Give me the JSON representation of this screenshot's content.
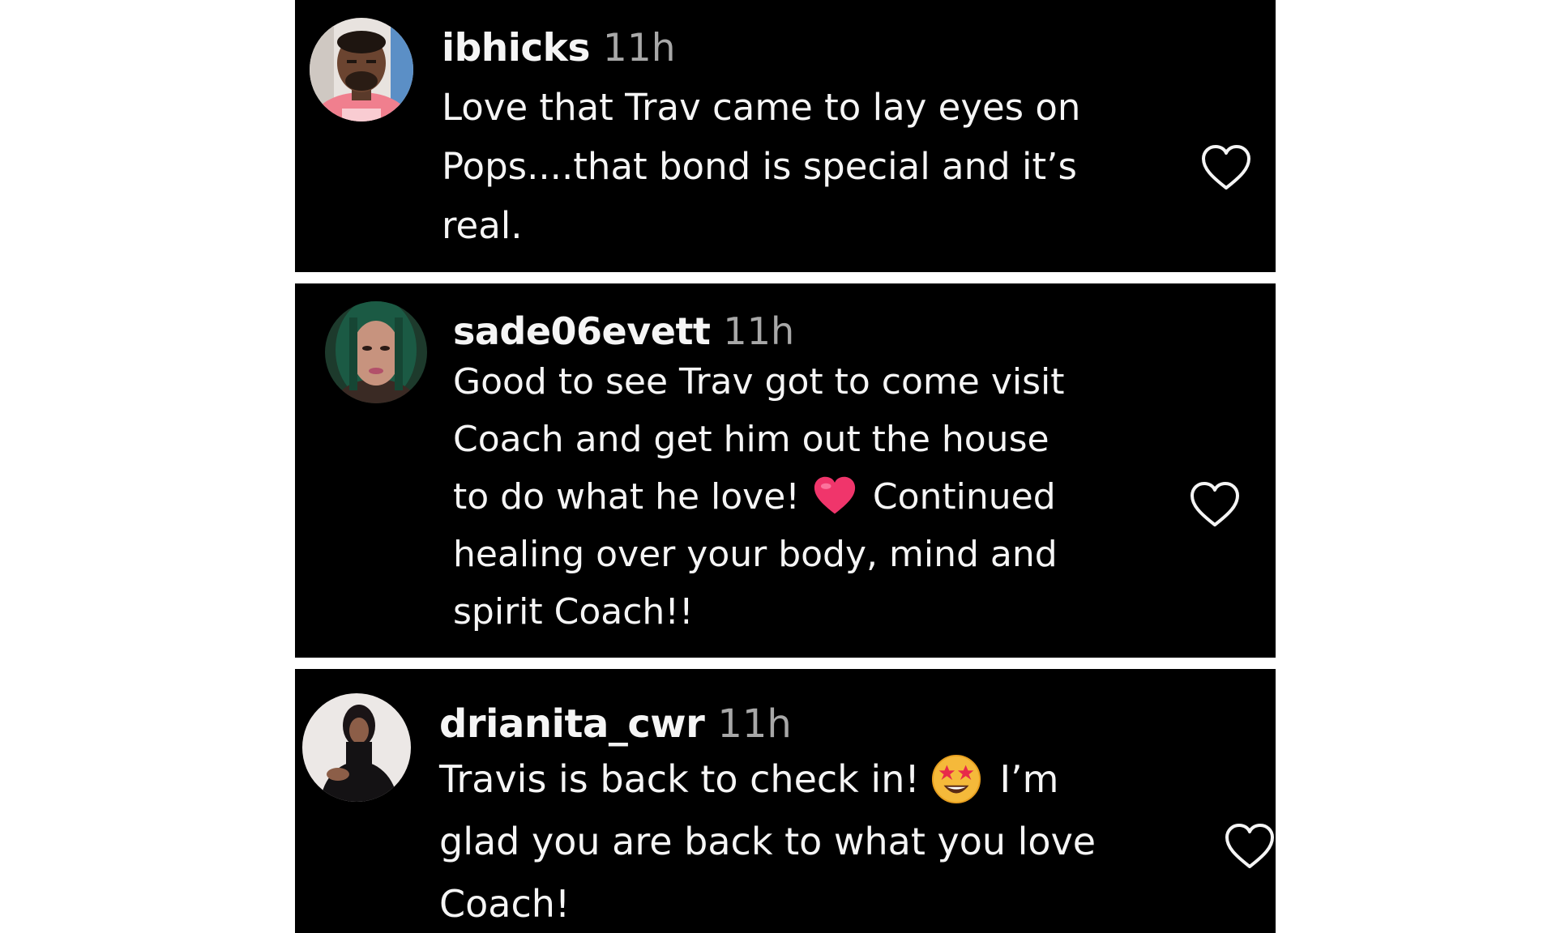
{
  "comments": [
    {
      "username": "ibhicks",
      "time": "11h",
      "lines": [
        "Love that Trav came to lay eyes on",
        "Pops....that bond is special and it’s",
        "real."
      ]
    },
    {
      "username": "sade06evett",
      "time": "11h",
      "lines": [
        "Good to see Trav got to come visit",
        "Coach and get him out the house",
        [
          "to do what he love! ",
          "Continued"
        ],
        "healing over your body, mind and",
        "spirit Coach!!"
      ]
    },
    {
      "username": "drianita_cwr",
      "time": "11h",
      "lines": [
        [
          "Travis is back to check in! ",
          "I’m"
        ],
        "glad you are back to what you love",
        "Coach!"
      ]
    }
  ],
  "icons": {
    "like": "heart-outline-icon",
    "heart_emoji": "red-heart-emoji",
    "star_eyes_emoji": "star-struck-emoji"
  },
  "colors": {
    "panel_bg": "#000000",
    "text": "#f5f5f5",
    "time": "#a8a8a8",
    "heart_emoji": "#f0356b",
    "star_emoji": "#f5b93a"
  }
}
